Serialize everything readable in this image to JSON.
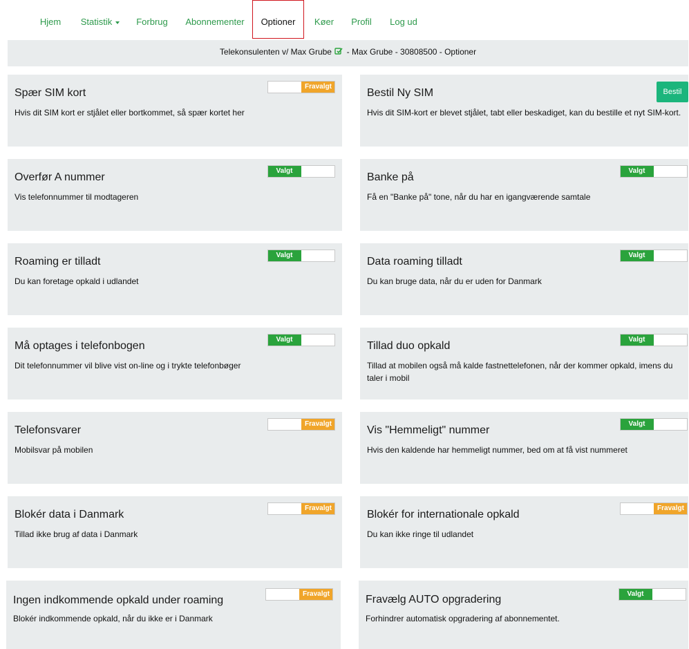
{
  "nav": {
    "items": [
      {
        "label": "Hjem"
      },
      {
        "label": "Statistik"
      },
      {
        "label": "Forbrug"
      },
      {
        "label": "Abonnementer"
      },
      {
        "label": "Optioner",
        "active": true
      },
      {
        "label": "Køer"
      },
      {
        "label": "Profil"
      },
      {
        "label": "Log ud"
      }
    ]
  },
  "info": {
    "before": "Telekonsulenten v/ Max Grube",
    "after": "- Max Grube - 30808500 - Optioner"
  },
  "colors": {
    "accent_green": "#2e9a4c",
    "toggle_on": "#2aa33c",
    "toggle_off": "#f0a52a",
    "button_teal": "#1bb57c",
    "panel_bg": "#e9eced"
  },
  "cards": [
    {
      "title": "Spær SIM kort",
      "desc": "Hvis dit SIM kort er stjålet eller bortkommet, så spær kortet her",
      "state": "Fravalgt"
    },
    {
      "title": "Bestil Ny SIM",
      "desc": "Hvis dit SIM-kort er blevet stjålet, tabt eller beskadiget, kan du bestille et nyt SIM-kort.",
      "button": "Bestil"
    },
    {
      "title": "Overfør A nummer",
      "desc": "Vis telefonnummer til modtageren",
      "state": "Valgt"
    },
    {
      "title": "Banke på",
      "desc": "Få en \"Banke på\" tone, når du har en igangværende samtale",
      "state": "Valgt"
    },
    {
      "title": "Roaming er tilladt",
      "desc": "Du kan foretage opkald i udlandet",
      "state": "Valgt"
    },
    {
      "title": "Data roaming tilladt",
      "desc": "Du kan bruge data, når du er uden for Danmark",
      "state": "Valgt"
    },
    {
      "title": "Må optages i telefonbogen",
      "desc": "Dit telefonnummer vil blive vist on-line og i trykte telefonbøger",
      "state": "Valgt"
    },
    {
      "title": "Tillad duo opkald",
      "desc": "Tillad at mobilen også må kalde fastnettelefonen, når der kommer opkald, imens du taler i mobil",
      "state": "Valgt"
    },
    {
      "title": "Telefonsvarer",
      "desc": "Mobilsvar på mobilen",
      "state": "Fravalgt"
    },
    {
      "title": "Vis \"Hemmeligt\" nummer",
      "desc": "Hvis den kaldende har hemmeligt nummer, bed om at få vist nummeret",
      "state": "Valgt"
    },
    {
      "title": "Blokér data i Danmark",
      "desc": "Tillad ikke brug af data i Danmark",
      "state": "Fravalgt"
    },
    {
      "title": "Blokér for internationale opkald",
      "desc": "Du kan ikke ringe til udlandet",
      "state": "Fravalgt"
    },
    {
      "title": "Ingen indkommende opkald under roaming",
      "desc": "Blokér indkommende opkald, når du ikke er i Danmark",
      "state": "Fravalgt"
    },
    {
      "title": "Fravælg AUTO opgradering",
      "desc": "Forhindrer automatisk opgradering af abonnementet.",
      "state": "Valgt"
    }
  ]
}
